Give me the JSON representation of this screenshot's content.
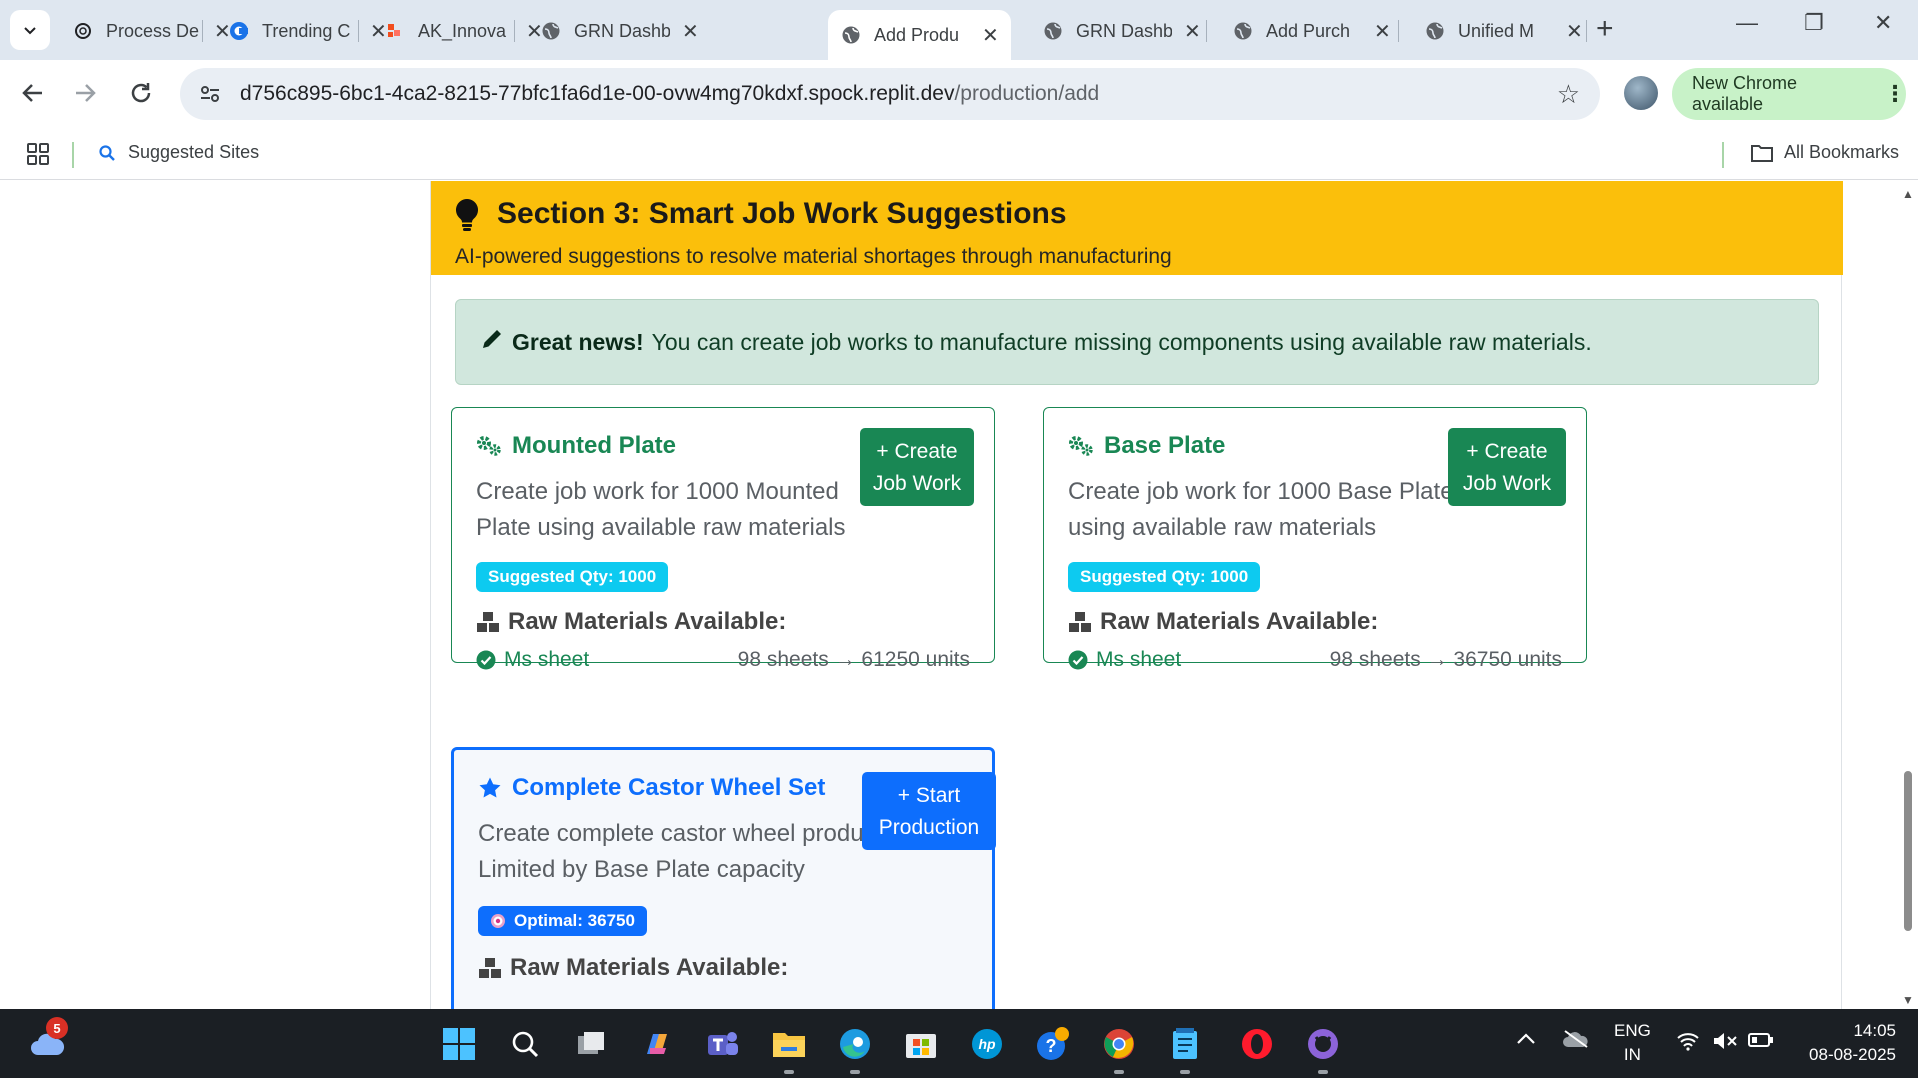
{
  "browser": {
    "tabs": [
      {
        "title": "Process De",
        "favicon": "openai-icon",
        "active": false
      },
      {
        "title": "Trending C",
        "favicon": "c-logo-icon",
        "active": false
      },
      {
        "title": "AK_Innova",
        "favicon": "figma-icon",
        "active": false
      },
      {
        "title": "GRN Dashb",
        "favicon": "globe-icon",
        "active": false
      },
      {
        "title": "Add Produ",
        "favicon": "globe-icon",
        "active": true
      },
      {
        "title": "GRN Dashb",
        "favicon": "globe-icon",
        "active": false
      },
      {
        "title": "Add Purch",
        "favicon": "globe-icon",
        "active": false
      },
      {
        "title": "Unified M",
        "favicon": "globe-icon",
        "active": false
      }
    ],
    "url_host": "d756c895-6bc1-4ca2-8215-77bfc1fa6d1e-00-ovw4mg70kdxf.spock.replit.dev",
    "url_path": "/production/add",
    "update_label": "New Chrome available",
    "bookmarks": {
      "suggested": "Suggested Sites",
      "all": "All Bookmarks"
    }
  },
  "section": {
    "title": "Section 3: Smart Job Work Suggestions",
    "subtitle": "AI-powered suggestions to resolve material shortages through manufacturing",
    "header_color": "#fbbf0b",
    "alert_bold": "Great news!",
    "alert_text": "You can create job works to manufacture missing components using available raw materials."
  },
  "cards": [
    {
      "title": "Mounted Plate",
      "description": "Create job work for 1000 Mounted Plate using available raw materials",
      "button_line1": "+ Create",
      "button_line2": "Job Work",
      "badge": "Suggested Qty: 1000",
      "raw_heading": "Raw Materials Available:",
      "material": "Ms sheet",
      "conversion": "98 sheets → 61250 units"
    },
    {
      "title": "Base Plate",
      "description": "Create job work for 1000 Base Plate using available raw materials",
      "button_line1": "+ Create",
      "button_line2": "Job Work",
      "badge": "Suggested Qty: 1000",
      "raw_heading": "Raw Materials Available:",
      "material": "Ms sheet",
      "conversion": "98 sheets → 36750 units"
    },
    {
      "title": "Complete Castor Wheel Set",
      "description": "Create complete castor wheel production - Limited by Base Plate capacity",
      "button_line1": "+ Start",
      "button_line2": "Production",
      "badge": "Optimal: 36750",
      "raw_heading": "Raw Materials Available:"
    }
  ],
  "taskbar": {
    "weather_badge": "5",
    "lang_line1": "ENG",
    "lang_line2": "IN",
    "time": "14:05",
    "date": "08-08-2025"
  },
  "colors": {
    "success": "#198754",
    "primary": "#0d6efd",
    "info": "#0dcaf0",
    "warning": "#fbbf0b"
  }
}
